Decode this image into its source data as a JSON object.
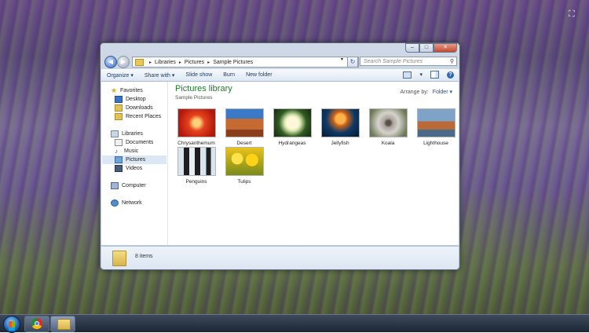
{
  "window": {
    "caption_buttons": {
      "minimize": "–",
      "maximize": "□",
      "close": "✕"
    },
    "address": {
      "crumbs": [
        "Libraries",
        "Pictures",
        "Sample Pictures"
      ]
    },
    "search_placeholder": "Search Sample Pictures",
    "toolbar": {
      "organize": "Organize ▾",
      "share_with": "Share with ▾",
      "slide_show": "Slide show",
      "burn": "Burn",
      "new_folder": "New folder"
    },
    "nav": {
      "favorites": "Favorites",
      "desktop": "Desktop",
      "downloads": "Downloads",
      "recent_places": "Recent Places",
      "libraries": "Libraries",
      "documents": "Documents",
      "music": "Music",
      "pictures": "Pictures",
      "videos": "Videos",
      "computer": "Computer",
      "network": "Network"
    },
    "content": {
      "title": "Pictures library",
      "subtitle": "Sample Pictures",
      "arrange_by_label": "Arrange by:",
      "arrange_by_value": "Folder ▾",
      "items": [
        {
          "name": "Chrysanthemum"
        },
        {
          "name": "Desert"
        },
        {
          "name": "Hydrangeas"
        },
        {
          "name": "Jellyfish"
        },
        {
          "name": "Koala"
        },
        {
          "name": "Lighthouse"
        },
        {
          "name": "Penguins"
        },
        {
          "name": "Tulips"
        }
      ]
    },
    "status": {
      "count": "8 items"
    }
  },
  "colors": {
    "library_title": "#1e7a2a",
    "toolbar_text": "#1e3a6e",
    "selected_nav": "#dce7f5"
  }
}
